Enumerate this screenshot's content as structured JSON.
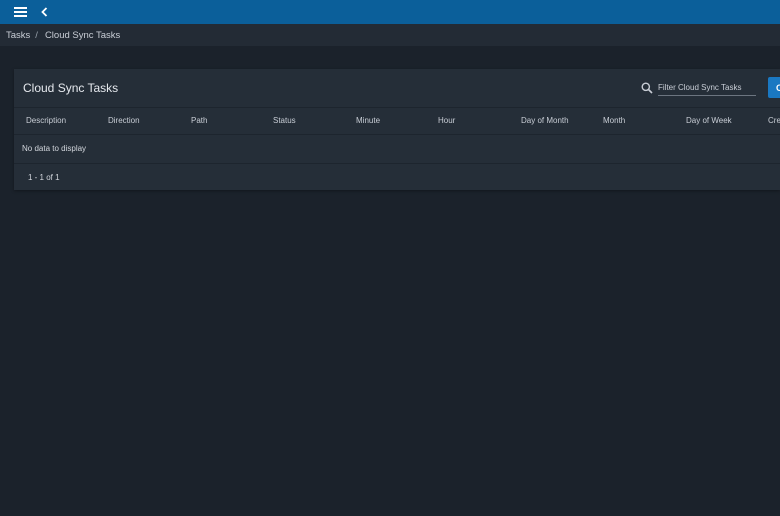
{
  "topbar": {
    "menu_icon": "hamburger-menu-icon",
    "back_icon": "chevron-left-icon",
    "color": "#0b5f9a"
  },
  "breadcrumb": {
    "items": [
      "Tasks",
      "Cloud Sync Tasks"
    ],
    "separator": "/"
  },
  "card": {
    "title": "Cloud Sync Tasks",
    "filter_placeholder": "Filter Cloud Sync Tasks",
    "create_button_label": "C",
    "columns": [
      "Description",
      "Direction",
      "Path",
      "Status",
      "Minute",
      "Hour",
      "Day of Month",
      "Month",
      "Day of Week",
      "Cre"
    ],
    "empty_message": "No data to display",
    "range_label": "1 - 1 of 1"
  },
  "colors": {
    "background": "#1b222b",
    "card": "#252e38",
    "accent": "#1a78c2"
  }
}
